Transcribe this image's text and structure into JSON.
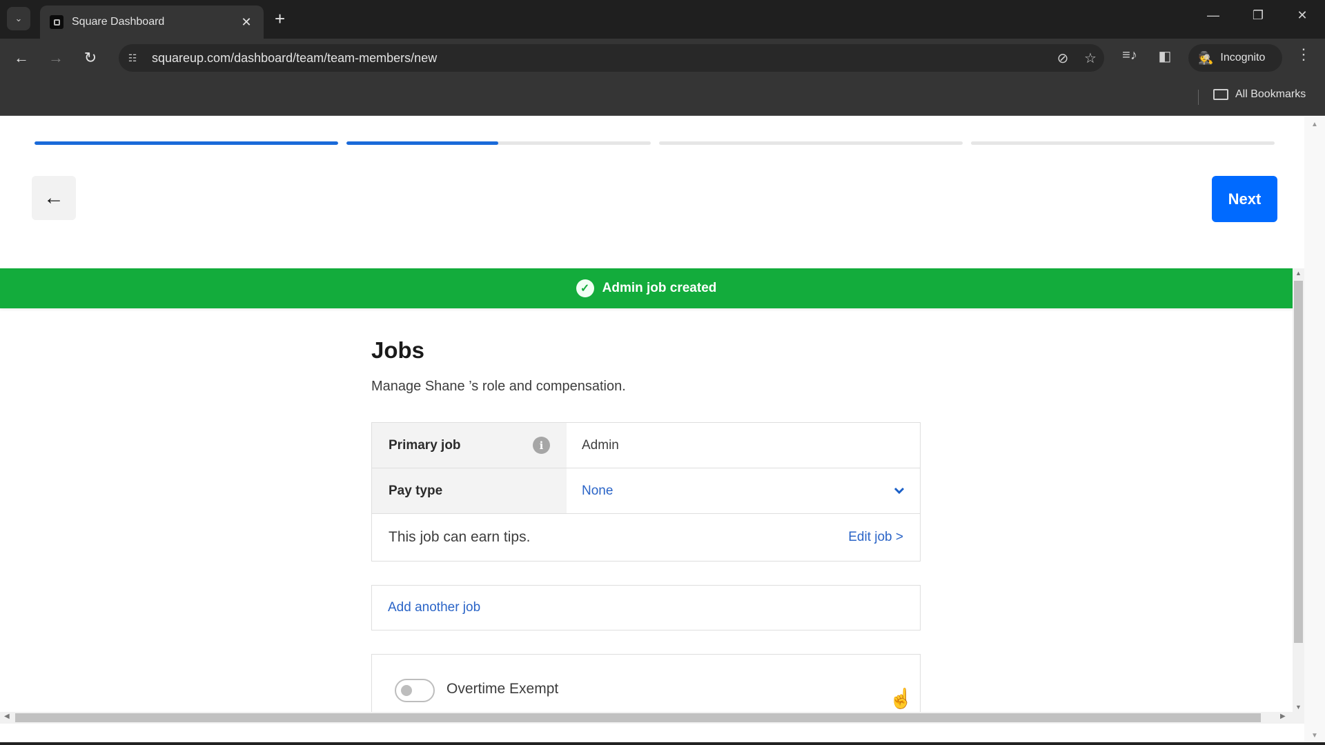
{
  "browser": {
    "tab_title": "Square Dashboard",
    "url": "squareup.com/dashboard/team/team-members/new",
    "profile_label": "Incognito",
    "bookmarks_label": "All Bookmarks",
    "icons": {
      "tab_search": "chevron-down-icon",
      "tab_close": "close-icon",
      "new_tab": "plus-icon",
      "back": "arrow-left-icon",
      "forward": "arrow-right-icon",
      "reload": "reload-icon",
      "site_info": "tune-icon",
      "tracking": "eye-off-icon",
      "bookmark": "star-icon",
      "media": "media-queue-icon",
      "side_panel": "side-panel-icon",
      "menu": "more-vert-icon"
    },
    "glyphs": {
      "tab_search": "⌄",
      "tab_close": "✕",
      "new_tab": "+",
      "back": "←",
      "forward": "→",
      "reload": "↻",
      "site_info": "☷",
      "tracking": "⊘",
      "bookmark": "☆",
      "media": "≡♪",
      "side_panel": "◧",
      "incognito": "🕵",
      "menu": "⋮",
      "minimize": "—",
      "restore": "❐",
      "close": "✕"
    }
  },
  "wizard": {
    "steps": [
      {
        "progress": 1.0
      },
      {
        "progress": 0.5
      },
      {
        "progress": 0.0
      },
      {
        "progress": 0.0
      }
    ],
    "back_glyph": "←",
    "next_label": "Next",
    "accent_color": "#006aff"
  },
  "banner": {
    "message": "Admin job created",
    "icon_glyph": "✓",
    "color": "#13ac3c"
  },
  "jobs": {
    "title": "Jobs",
    "subtitle": "Manage Shane ’s role and compensation.",
    "primary_job": {
      "label": "Primary job",
      "info_glyph": "i",
      "value": "Admin"
    },
    "pay_type": {
      "label": "Pay type",
      "selected": "None",
      "chevron_glyph": "⌄"
    },
    "tips_text": "This job can earn tips.",
    "edit_job_label": "Edit job >",
    "add_another_job_label": "Add another job",
    "overtime_exempt": {
      "label": "Overtime Exempt",
      "enabled": false
    }
  }
}
